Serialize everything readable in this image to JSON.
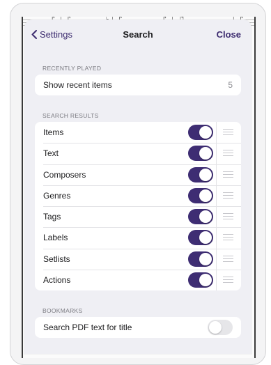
{
  "nav": {
    "back_label": "Settings",
    "title": "Search",
    "close_label": "Close"
  },
  "recently_played": {
    "header": "RECENTLY PLAYED",
    "row": {
      "label": "Show recent items",
      "value": "5"
    }
  },
  "search_results": {
    "header": "SEARCH RESULTS",
    "items": [
      {
        "label": "Items",
        "enabled": true
      },
      {
        "label": "Text",
        "enabled": true
      },
      {
        "label": "Composers",
        "enabled": true
      },
      {
        "label": "Genres",
        "enabled": true
      },
      {
        "label": "Tags",
        "enabled": true
      },
      {
        "label": "Labels",
        "enabled": true
      },
      {
        "label": "Setlists",
        "enabled": true
      },
      {
        "label": "Actions",
        "enabled": true
      }
    ]
  },
  "bookmarks": {
    "header": "BOOKMARKS",
    "row": {
      "label": "Search PDF text for title",
      "enabled": false
    }
  },
  "colors": {
    "accent": "#3e2d73",
    "background": "#efeff4",
    "toggle_off": "#e6e6e9"
  }
}
